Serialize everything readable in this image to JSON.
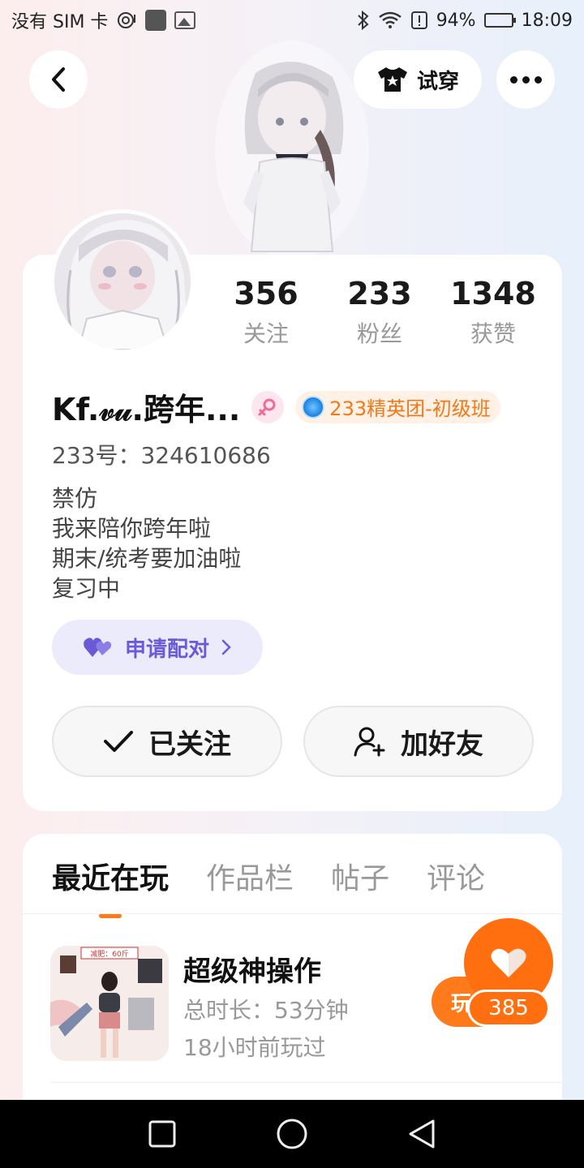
{
  "status_bar": {
    "carrier": "没有 SIM 卡",
    "battery": "94%",
    "time": "18:09",
    "battery_level": 0.94
  },
  "header": {
    "tryon_label": "试穿"
  },
  "profile": {
    "stats": [
      {
        "value": "356",
        "label": "关注"
      },
      {
        "value": "233",
        "label": "粉丝"
      },
      {
        "value": "1348",
        "label": "获赞"
      }
    ],
    "username": "Kf.𝓋𝓊.跨年...",
    "rank_badge": "233精英团-初级班",
    "user_id": "233号：324610686",
    "bio": [
      "禁仿",
      "我来陪你跨年啦",
      "期末/统考要加油啦",
      "复习中"
    ],
    "pair_button": "申请配对",
    "follow_button": "已关注",
    "add_friend_button": "加好友"
  },
  "tabs": [
    "最近在玩",
    "作品栏",
    "帖子",
    "评论"
  ],
  "games": [
    {
      "title": "超级神操作",
      "duration": "总时长：53分钟",
      "last_played": "18小时前玩过",
      "play_label": "玩",
      "thumb_text": "减肥：60斤"
    }
  ],
  "like_float": {
    "count": "385"
  },
  "colors": {
    "accent": "#ff7a1a",
    "pair_purple": "#6a5ad8",
    "rank_orange": "#f07a1a"
  }
}
